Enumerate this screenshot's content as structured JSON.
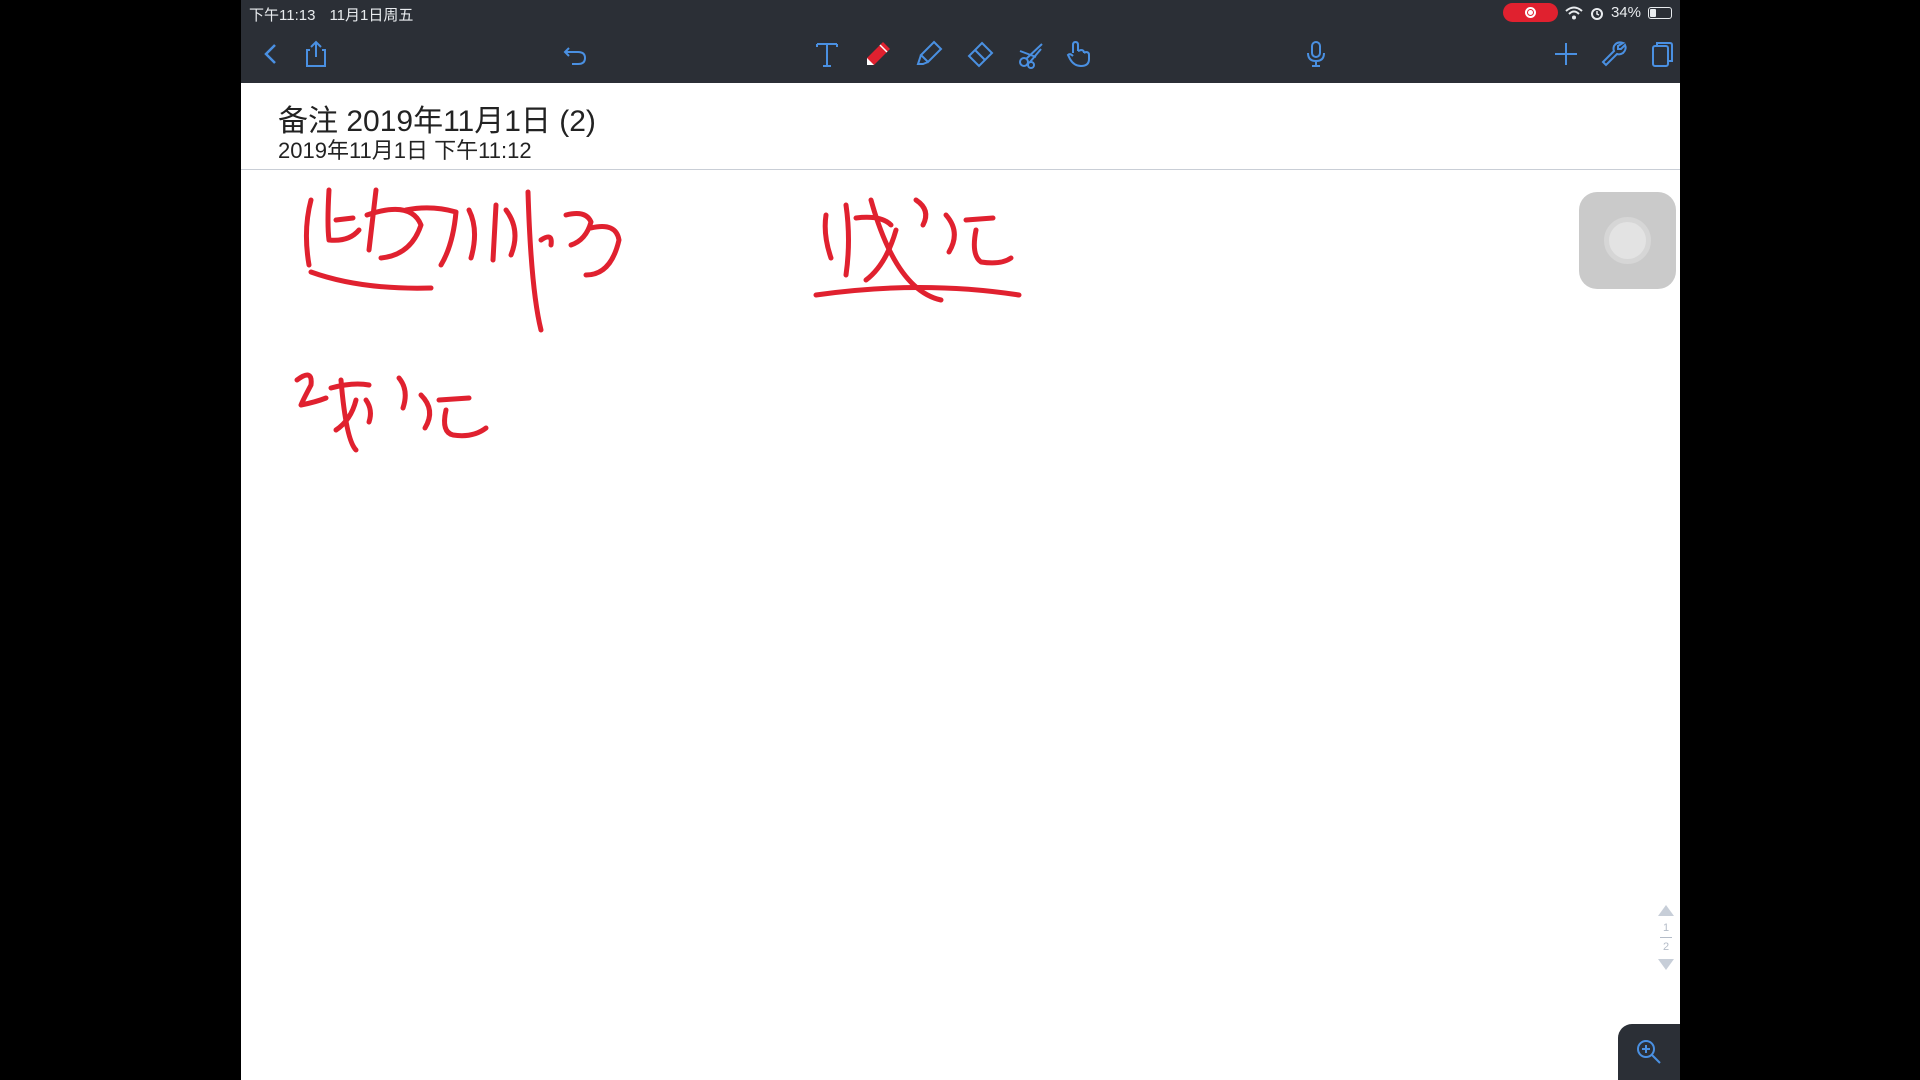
{
  "status_bar": {
    "time": "下午11:13",
    "date": "11月1日周五",
    "battery_percent": "34%",
    "battery_level": 0.34
  },
  "toolbar": {
    "icons": [
      "back-icon",
      "share-icon",
      "undo-icon",
      "text-tool-icon",
      "pen-tool-icon",
      "highlighter-icon",
      "eraser-icon",
      "lasso-scissors-icon",
      "hand-pointer-icon",
      "microphone-icon",
      "add-icon",
      "settings-wrench-icon",
      "pages-icon"
    ],
    "accent": "#4a90e2",
    "pen_color": "#e0212f"
  },
  "note": {
    "title": "备注 2019年11月1日 (2)",
    "created": "2019年11月1日 下午11:12"
  },
  "ink": {
    "color": "#e0212f"
  },
  "pagination": {
    "current": "1",
    "total": "2"
  }
}
